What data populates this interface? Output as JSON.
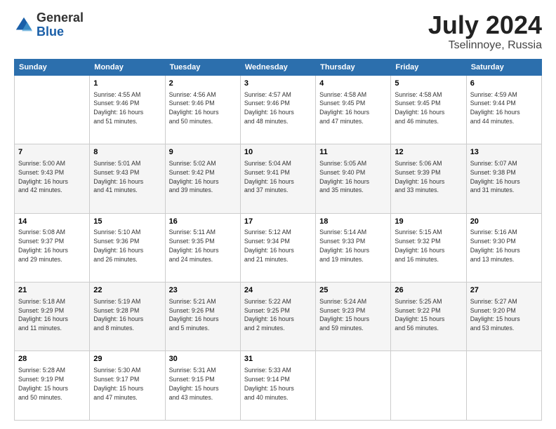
{
  "header": {
    "logo": {
      "general": "General",
      "blue": "Blue"
    },
    "title": "July 2024",
    "location": "Tselinnoye, Russia"
  },
  "days_of_week": [
    "Sunday",
    "Monday",
    "Tuesday",
    "Wednesday",
    "Thursday",
    "Friday",
    "Saturday"
  ],
  "weeks": [
    [
      {
        "num": "",
        "info": ""
      },
      {
        "num": "1",
        "info": "Sunrise: 4:55 AM\nSunset: 9:46 PM\nDaylight: 16 hours\nand 51 minutes."
      },
      {
        "num": "2",
        "info": "Sunrise: 4:56 AM\nSunset: 9:46 PM\nDaylight: 16 hours\nand 50 minutes."
      },
      {
        "num": "3",
        "info": "Sunrise: 4:57 AM\nSunset: 9:46 PM\nDaylight: 16 hours\nand 48 minutes."
      },
      {
        "num": "4",
        "info": "Sunrise: 4:58 AM\nSunset: 9:45 PM\nDaylight: 16 hours\nand 47 minutes."
      },
      {
        "num": "5",
        "info": "Sunrise: 4:58 AM\nSunset: 9:45 PM\nDaylight: 16 hours\nand 46 minutes."
      },
      {
        "num": "6",
        "info": "Sunrise: 4:59 AM\nSunset: 9:44 PM\nDaylight: 16 hours\nand 44 minutes."
      }
    ],
    [
      {
        "num": "7",
        "info": "Sunrise: 5:00 AM\nSunset: 9:43 PM\nDaylight: 16 hours\nand 42 minutes."
      },
      {
        "num": "8",
        "info": "Sunrise: 5:01 AM\nSunset: 9:43 PM\nDaylight: 16 hours\nand 41 minutes."
      },
      {
        "num": "9",
        "info": "Sunrise: 5:02 AM\nSunset: 9:42 PM\nDaylight: 16 hours\nand 39 minutes."
      },
      {
        "num": "10",
        "info": "Sunrise: 5:04 AM\nSunset: 9:41 PM\nDaylight: 16 hours\nand 37 minutes."
      },
      {
        "num": "11",
        "info": "Sunrise: 5:05 AM\nSunset: 9:40 PM\nDaylight: 16 hours\nand 35 minutes."
      },
      {
        "num": "12",
        "info": "Sunrise: 5:06 AM\nSunset: 9:39 PM\nDaylight: 16 hours\nand 33 minutes."
      },
      {
        "num": "13",
        "info": "Sunrise: 5:07 AM\nSunset: 9:38 PM\nDaylight: 16 hours\nand 31 minutes."
      }
    ],
    [
      {
        "num": "14",
        "info": "Sunrise: 5:08 AM\nSunset: 9:37 PM\nDaylight: 16 hours\nand 29 minutes."
      },
      {
        "num": "15",
        "info": "Sunrise: 5:10 AM\nSunset: 9:36 PM\nDaylight: 16 hours\nand 26 minutes."
      },
      {
        "num": "16",
        "info": "Sunrise: 5:11 AM\nSunset: 9:35 PM\nDaylight: 16 hours\nand 24 minutes."
      },
      {
        "num": "17",
        "info": "Sunrise: 5:12 AM\nSunset: 9:34 PM\nDaylight: 16 hours\nand 21 minutes."
      },
      {
        "num": "18",
        "info": "Sunrise: 5:14 AM\nSunset: 9:33 PM\nDaylight: 16 hours\nand 19 minutes."
      },
      {
        "num": "19",
        "info": "Sunrise: 5:15 AM\nSunset: 9:32 PM\nDaylight: 16 hours\nand 16 minutes."
      },
      {
        "num": "20",
        "info": "Sunrise: 5:16 AM\nSunset: 9:30 PM\nDaylight: 16 hours\nand 13 minutes."
      }
    ],
    [
      {
        "num": "21",
        "info": "Sunrise: 5:18 AM\nSunset: 9:29 PM\nDaylight: 16 hours\nand 11 minutes."
      },
      {
        "num": "22",
        "info": "Sunrise: 5:19 AM\nSunset: 9:28 PM\nDaylight: 16 hours\nand 8 minutes."
      },
      {
        "num": "23",
        "info": "Sunrise: 5:21 AM\nSunset: 9:26 PM\nDaylight: 16 hours\nand 5 minutes."
      },
      {
        "num": "24",
        "info": "Sunrise: 5:22 AM\nSunset: 9:25 PM\nDaylight: 16 hours\nand 2 minutes."
      },
      {
        "num": "25",
        "info": "Sunrise: 5:24 AM\nSunset: 9:23 PM\nDaylight: 15 hours\nand 59 minutes."
      },
      {
        "num": "26",
        "info": "Sunrise: 5:25 AM\nSunset: 9:22 PM\nDaylight: 15 hours\nand 56 minutes."
      },
      {
        "num": "27",
        "info": "Sunrise: 5:27 AM\nSunset: 9:20 PM\nDaylight: 15 hours\nand 53 minutes."
      }
    ],
    [
      {
        "num": "28",
        "info": "Sunrise: 5:28 AM\nSunset: 9:19 PM\nDaylight: 15 hours\nand 50 minutes."
      },
      {
        "num": "29",
        "info": "Sunrise: 5:30 AM\nSunset: 9:17 PM\nDaylight: 15 hours\nand 47 minutes."
      },
      {
        "num": "30",
        "info": "Sunrise: 5:31 AM\nSunset: 9:15 PM\nDaylight: 15 hours\nand 43 minutes."
      },
      {
        "num": "31",
        "info": "Sunrise: 5:33 AM\nSunset: 9:14 PM\nDaylight: 15 hours\nand 40 minutes."
      },
      {
        "num": "",
        "info": ""
      },
      {
        "num": "",
        "info": ""
      },
      {
        "num": "",
        "info": ""
      }
    ]
  ]
}
